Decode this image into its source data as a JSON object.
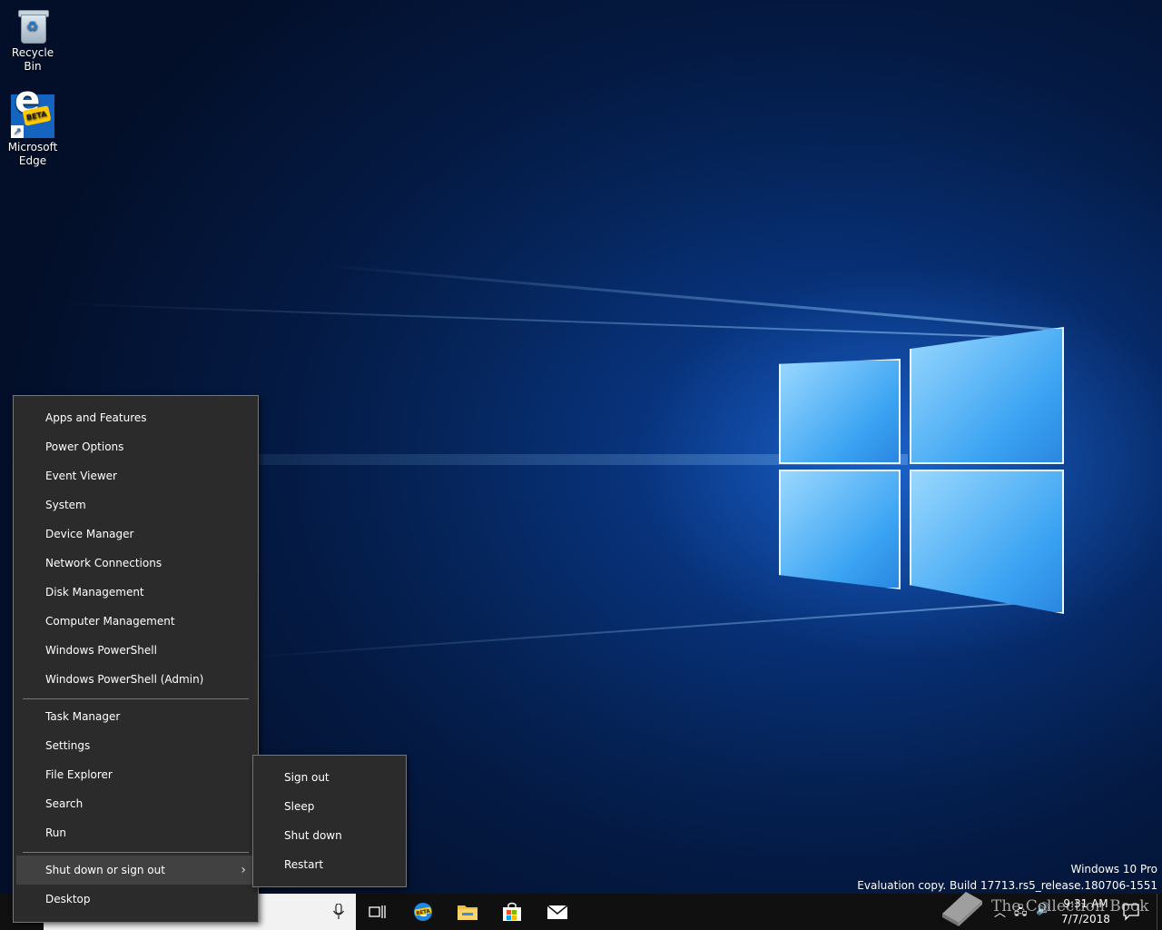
{
  "desktop": {
    "icons": [
      {
        "label": "Recycle Bin",
        "icon": "recycle-bin-icon"
      },
      {
        "label": "Microsoft\nEdge",
        "icon": "edge-beta-icon",
        "badge": "BETA"
      }
    ],
    "watermark": {
      "product": "Windows 10 Pro",
      "build": "Evaluation copy. Build 17713.rs5_release.180706-1551"
    }
  },
  "winx_menu": {
    "items": [
      "Apps and Features",
      "Power Options",
      "Event Viewer",
      "System",
      "Device Manager",
      "Network Connections",
      "Disk Management",
      "Computer Management",
      "Windows PowerShell",
      "Windows PowerShell (Admin)",
      "Task Manager",
      "Settings",
      "File Explorer",
      "Search",
      "Run",
      "Shut down or sign out",
      "Desktop"
    ],
    "active_item": "Shut down or sign out"
  },
  "power_submenu": {
    "items": [
      "Sign out",
      "Sleep",
      "Shut down",
      "Restart"
    ]
  },
  "taskbar": {
    "pinned": [
      "task-view-icon",
      "edge-beta-icon",
      "file-explorer-icon",
      "microsoft-store-icon",
      "mail-icon"
    ],
    "edge_badge": "BETA",
    "clock": {
      "time": "9:31 AM",
      "date": "7/7/2018"
    },
    "tray": [
      "chevron-up-icon",
      "network-icon",
      "volume-icon",
      "action-center-icon"
    ]
  },
  "overlay_watermark": "The Collection Book",
  "colors": {
    "menu_bg": "#2b2b2b",
    "menu_active": "#414141",
    "taskbar_bg": "#101010",
    "accent": "#1565c0"
  }
}
